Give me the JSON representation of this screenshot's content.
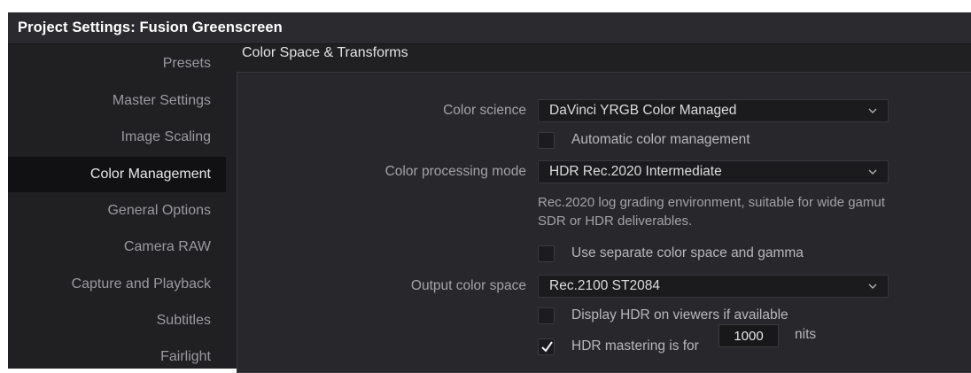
{
  "window": {
    "title": "Project Settings:  Fusion Greenscreen"
  },
  "sidebar": {
    "items": [
      {
        "label": "Presets",
        "active": false
      },
      {
        "label": "Master Settings",
        "active": false
      },
      {
        "label": "Image Scaling",
        "active": false
      },
      {
        "label": "Color Management",
        "active": true
      },
      {
        "label": "General Options",
        "active": false
      },
      {
        "label": "Camera RAW",
        "active": false
      },
      {
        "label": "Capture and Playback",
        "active": false
      },
      {
        "label": "Subtitles",
        "active": false
      },
      {
        "label": "Fairlight",
        "active": false
      }
    ]
  },
  "section": {
    "title": "Color Space & Transforms"
  },
  "settings": {
    "color_science": {
      "label": "Color science",
      "value": "DaVinci YRGB Color Managed"
    },
    "auto_color_mgmt": {
      "label": "Automatic color management",
      "checked": false
    },
    "color_processing_mode": {
      "label": "Color processing mode",
      "value": "HDR Rec.2020 Intermediate",
      "description": "Rec.2020 log grading environment, suitable for wide gamut SDR or HDR deliverables."
    },
    "separate_color_space": {
      "label": "Use separate color space and gamma",
      "checked": false
    },
    "output_color_space": {
      "label": "Output color space",
      "value": "Rec.2100 ST2084"
    },
    "display_hdr": {
      "label": "Display HDR on viewers if available",
      "checked": false
    },
    "hdr_mastering": {
      "label": "HDR mastering is for",
      "checked": true,
      "nits_value": "1000",
      "unit": "nits"
    }
  },
  "colors": {
    "window_bg": "#202023",
    "panel_bg": "#28282c",
    "active_sidebar_bg": "#111113",
    "text_primary": "#dcdcde",
    "text_secondary": "#a2a2a7"
  }
}
